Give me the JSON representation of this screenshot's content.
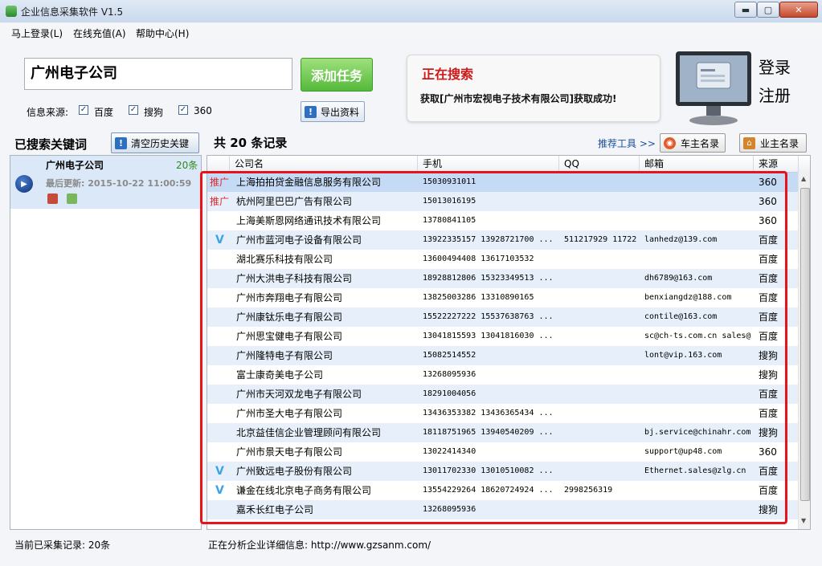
{
  "window": {
    "title": "企业信息采集软件 V1.5",
    "minimize": "▬",
    "maximize": "▢",
    "close": "✕"
  },
  "menu": [
    "马上登录(L)",
    "在线充值(A)",
    "帮助中心(H)"
  ],
  "search": {
    "keyword": "广州电子公司",
    "add_task": "添加任务",
    "export": "导出资料"
  },
  "sources": {
    "label": "信息来源:",
    "options": [
      "百度",
      "搜狗",
      "360"
    ]
  },
  "status": {
    "title": "正在搜索",
    "message": "获取[广州市宏视电子技术有限公司]获取成功!"
  },
  "account": {
    "login": "登录",
    "register": "注册"
  },
  "searched": {
    "title": "已搜索关键词",
    "clear": "清空历史关键",
    "item": {
      "keyword": "广州电子公司",
      "count": "20条",
      "updated": "最后更新: 2015-10-22 11:00:59"
    }
  },
  "records": {
    "summary": "共 20 条记录",
    "tools_link": "推荐工具 >>",
    "car_owner": "车主名录",
    "business_owner": "业主名录"
  },
  "table": {
    "columns": [
      "公司名",
      "手机",
      "QQ",
      "邮箱",
      "来源"
    ],
    "rows": [
      {
        "badge": "推广",
        "name": "上海拍拍贷金融信息服务有限公司",
        "phone": "15030931011",
        "qq": "",
        "email": "",
        "source": "360"
      },
      {
        "badge": "推广",
        "name": "杭州阿里巴巴广告有限公司",
        "phone": "15013016195",
        "qq": "",
        "email": "",
        "source": "360"
      },
      {
        "badge": "",
        "name": "上海美斯恩网络通讯技术有限公司",
        "phone": "13780841105",
        "qq": "",
        "email": "",
        "source": "360"
      },
      {
        "badge": "V",
        "name": "广州市蓝河电子设备有限公司",
        "phone": "13922335157  13928721700  ...",
        "qq": "511217929  11722",
        "email": "lanhedz@139.com",
        "source": "百度"
      },
      {
        "badge": "",
        "name": "湖北赛乐科技有限公司",
        "phone": "13600494408  13617103532",
        "qq": "",
        "email": "",
        "source": "百度"
      },
      {
        "badge": "",
        "name": "广州大洪电子科技有限公司",
        "phone": "18928812806  15323349513  ...",
        "qq": "",
        "email": "dh6789@163.com",
        "source": "百度"
      },
      {
        "badge": "",
        "name": "广州市奔翔电子有限公司",
        "phone": "13825003286  13310890165",
        "qq": "",
        "email": "benxiangdz@188.com",
        "source": "百度"
      },
      {
        "badge": "",
        "name": "广州康钛乐电子有限公司",
        "phone": "15522227222  15537638763  ...",
        "qq": "",
        "email": "contile@163.com",
        "source": "百度"
      },
      {
        "badge": "",
        "name": "广州思宝健电子有限公司",
        "phone": "13041815593  13041816030  ...",
        "qq": "",
        "email": "sc@ch-ts.com.cn sales@",
        "source": "百度"
      },
      {
        "badge": "",
        "name": "广州隆特电子有限公司",
        "phone": "15082514552",
        "qq": "",
        "email": "lont@vip.163.com",
        "source": "搜狗"
      },
      {
        "badge": "",
        "name": "富士康奇美电子公司",
        "phone": "13268095936",
        "qq": "",
        "email": "",
        "source": "搜狗"
      },
      {
        "badge": "",
        "name": "广州市天河双龙电子有限公司",
        "phone": "18291004056",
        "qq": "",
        "email": "",
        "source": "百度"
      },
      {
        "badge": "",
        "name": "广州市圣大电子有限公司",
        "phone": "13436353382  13436365434  ...",
        "qq": "",
        "email": "",
        "source": "百度"
      },
      {
        "badge": "",
        "name": "北京益佳信企业管理顾问有限公司",
        "phone": "18118751965  13940540209  ...",
        "qq": "",
        "email": "bj.service@chinahr.com",
        "source": "搜狗"
      },
      {
        "badge": "",
        "name": "广州市景天电子有限公司",
        "phone": "13022414340",
        "qq": "",
        "email": "support@up48.com",
        "source": "360"
      },
      {
        "badge": "V",
        "name": "广州致远电子股份有限公司",
        "phone": "13011702330  13010510082  ...",
        "qq": "",
        "email": "Ethernet.sales@zlg.cn",
        "source": "百度"
      },
      {
        "badge": "V",
        "name": "谦金在线北京电子商务有限公司",
        "phone": "13554229264  18620724924  ...",
        "qq": "2998256319",
        "email": "",
        "source": "百度"
      },
      {
        "badge": "",
        "name": "嘉禾长红电子公司",
        "phone": "13268095936",
        "qq": "",
        "email": "",
        "source": "搜狗"
      }
    ]
  },
  "footer": {
    "left": "当前已采集记录: 20条",
    "right": "正在分析企业详细信息: http://www.gzsanm.com/"
  },
  "colors": {
    "accent_green": "#55b93a",
    "status_red": "#cc1a1a",
    "promo_red": "#e0282c",
    "verified_blue": "#3da3e8",
    "row_alt": "#e7f0fa",
    "row_selected": "#c5daf4",
    "highlight_border": "#e8121b"
  }
}
